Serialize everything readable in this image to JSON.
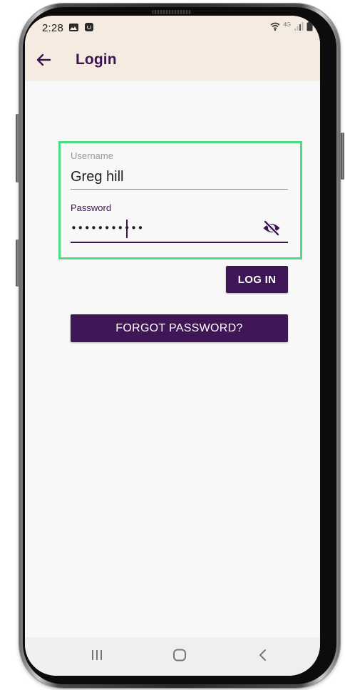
{
  "status_bar": {
    "time": "2:28",
    "network_label": "4G"
  },
  "app_bar": {
    "title": "Login",
    "back_icon": "arrow-back-icon"
  },
  "login_form": {
    "username": {
      "label": "Username",
      "value": "Greg hill"
    },
    "password": {
      "label": "Password",
      "masked_value": "•••••••••••",
      "visibility_icon": "eye-off-icon"
    }
  },
  "buttons": {
    "login_label": "LOG IN",
    "forgot_password_label": "FORGOT PASSWORD?"
  },
  "nav_bar": {
    "recents_icon": "recents-icon",
    "home_icon": "home-icon",
    "back_icon": "back-icon"
  },
  "colors": {
    "primary": "#3f1656",
    "app_bar_bg": "#f5ebe0",
    "highlight_box": "#4ade80",
    "screen_bg": "#f9f8f9"
  }
}
